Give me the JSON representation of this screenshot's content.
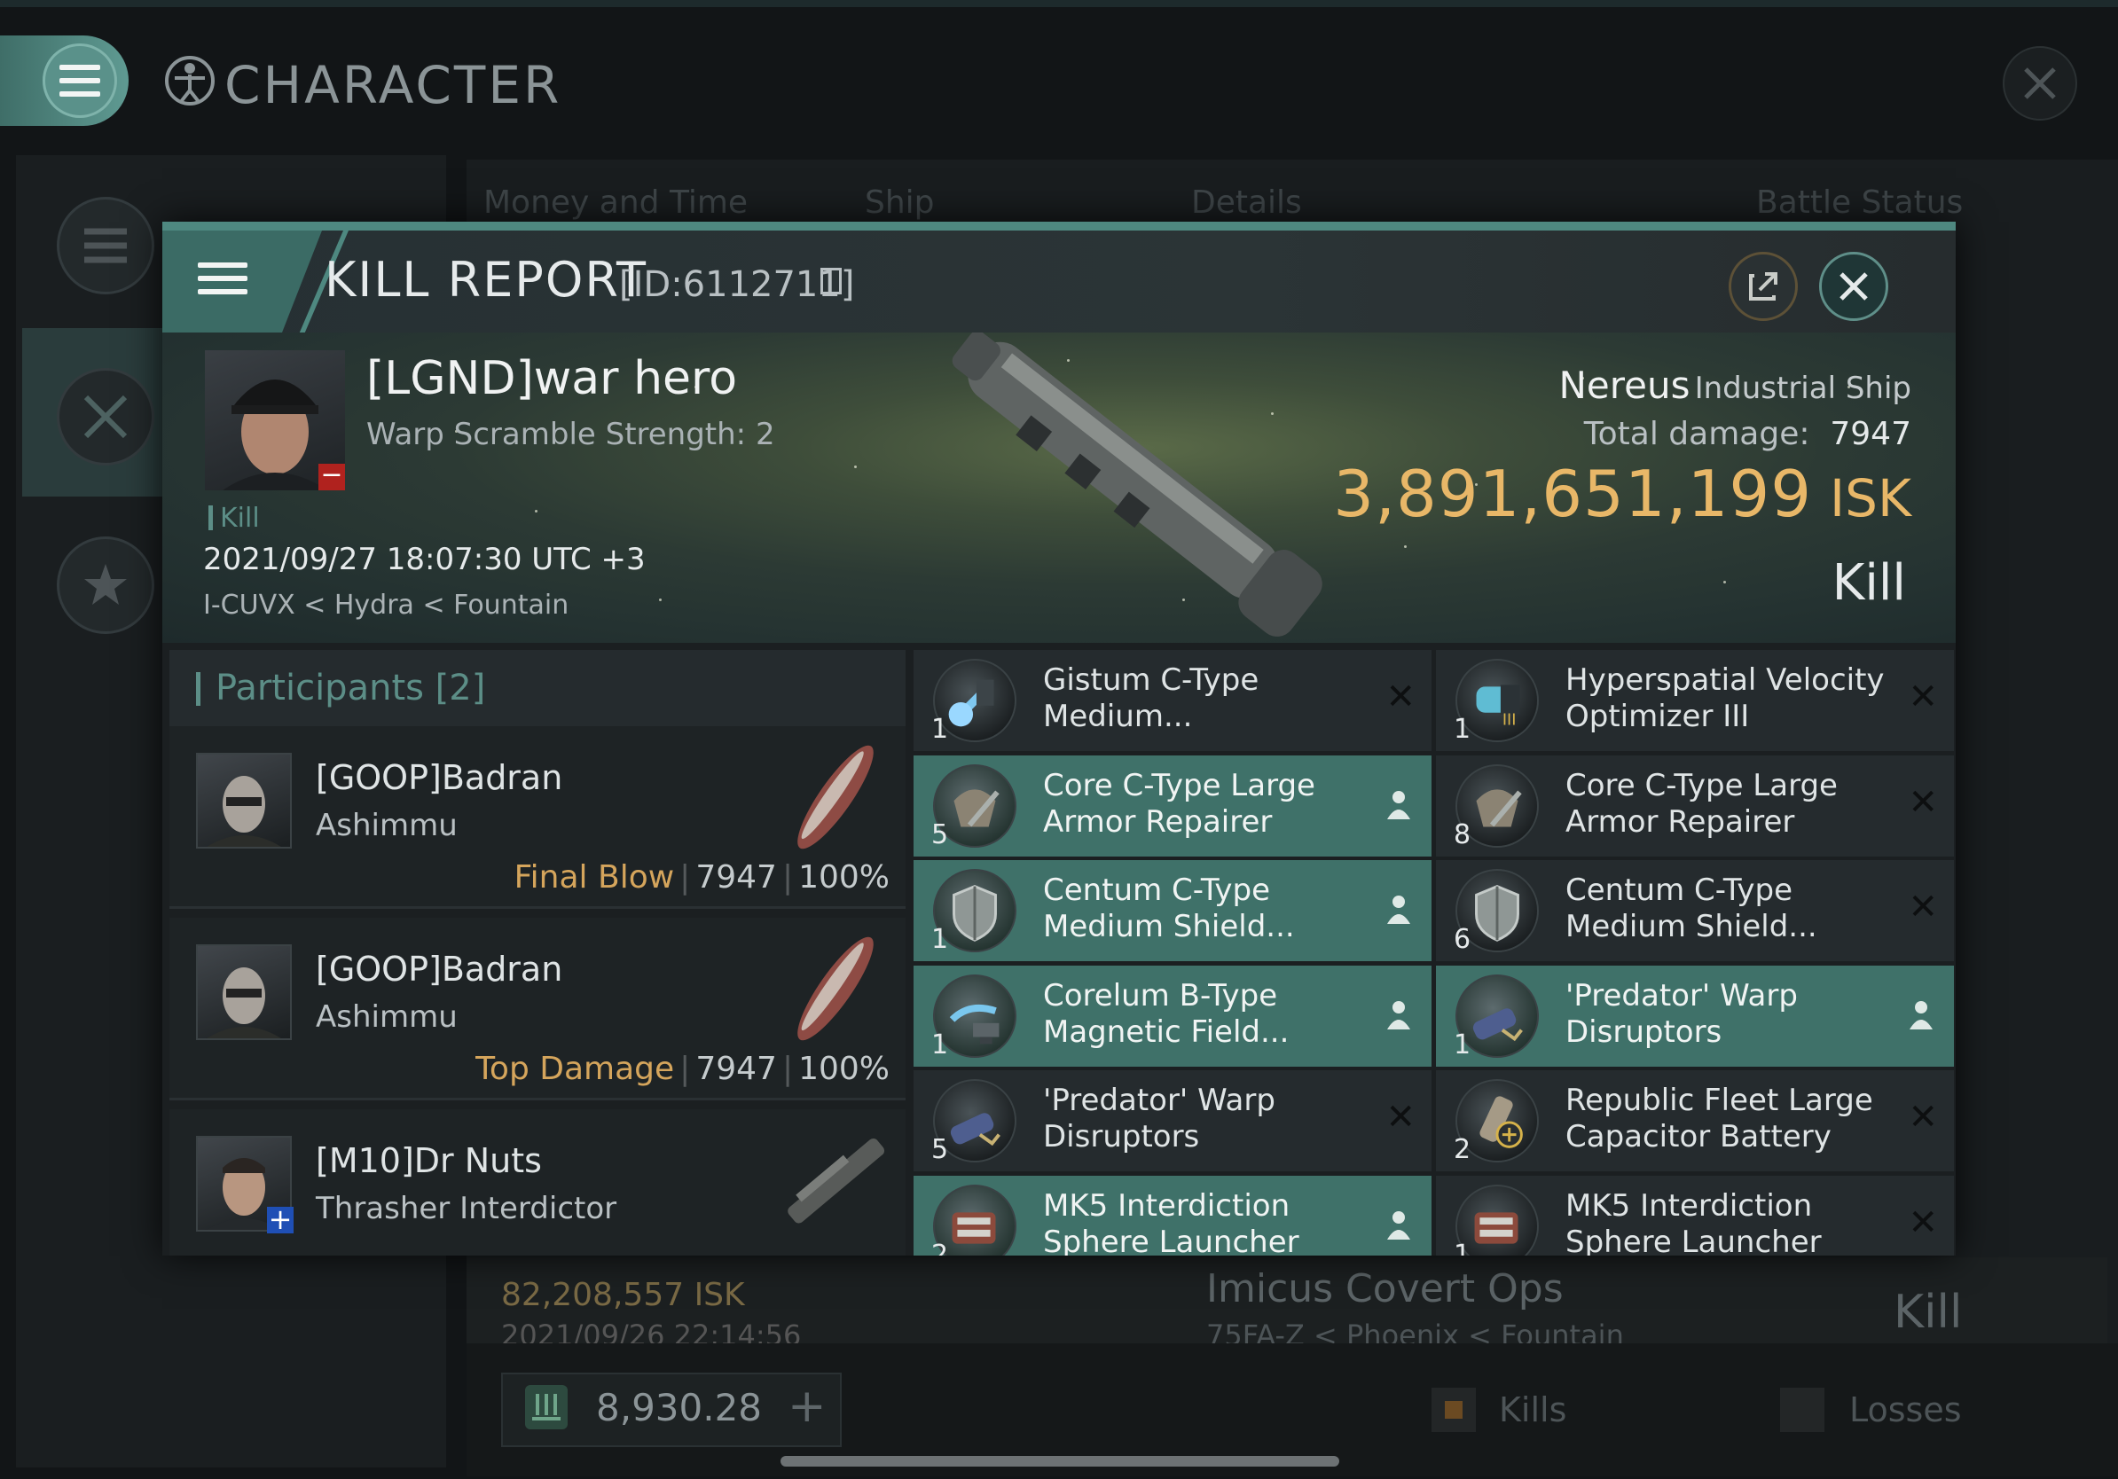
{
  "app": {
    "title": "CHARACTER",
    "icons": {
      "menu": "hamburger-icon",
      "character": "vitruvian-icon",
      "close": "close-icon"
    }
  },
  "background": {
    "tabs": [
      "Money and Time",
      "Ship",
      "Details",
      "Battle Status"
    ],
    "row": {
      "isk": "82,208,557  ISK",
      "date": "2021/09/26  22:14:56",
      "ship": "Imicus Covert Ops",
      "location": "75FA-Z < Phoenix < Fountain",
      "status": "Kill"
    },
    "wallet": {
      "value": "8,930.28",
      "plus": "+"
    },
    "filters": {
      "kills": "Kills",
      "losses": "Losses"
    }
  },
  "modal": {
    "title": "KILL REPORT",
    "id": "[ID:6112711]",
    "victim": {
      "name": "[LGND]war hero",
      "subtitle": "Warp Scramble Strength: 2",
      "tag": "Kill",
      "time": "2021/09/27 18:07:30 UTC +3",
      "location": "I-CUVX < Hydra < Fountain",
      "badge": "−"
    },
    "ship": {
      "name": "Nereus",
      "class": "Industrial Ship",
      "damage_label": "Total damage:",
      "damage": "7947",
      "isk": "3,891,651,199",
      "isk_unit": "ISK",
      "result": "Kill"
    },
    "participants": {
      "header": "Participants [2]",
      "items": [
        {
          "name": "[GOOP]Badran",
          "ship": "Ashimmu",
          "label": "Final Blow",
          "damage": "7947",
          "percent": "100%"
        },
        {
          "name": "[GOOP]Badran",
          "ship": "Ashimmu",
          "label": "Top Damage",
          "damage": "7947",
          "percent": "100%"
        },
        {
          "name": "[M10]Dr Nuts",
          "ship": "Thrasher Interdictor",
          "label": "",
          "damage": "",
          "percent": ""
        }
      ]
    },
    "modules": [
      {
        "name": "Gistum C-Type Medium...",
        "qty": "1",
        "state": "destroyed",
        "icon": "shield-booster-icon"
      },
      {
        "name": "Hyperspatial Velocity Optimizer III",
        "qty": "1",
        "state": "destroyed",
        "icon": "rig-icon"
      },
      {
        "name": "Core C-Type Large Armor Repairer",
        "qty": "5",
        "state": "dropped",
        "icon": "armor-repairer-icon"
      },
      {
        "name": "Core C-Type Large Armor Repairer",
        "qty": "8",
        "state": "destroyed",
        "icon": "armor-repairer-icon"
      },
      {
        "name": "Centum C-Type Medium Shield...",
        "qty": "1",
        "state": "dropped",
        "icon": "shield-extender-icon"
      },
      {
        "name": "Centum C-Type Medium Shield...",
        "qty": "6",
        "state": "destroyed",
        "icon": "shield-extender-icon"
      },
      {
        "name": "Corelum B-Type Magnetic Field...",
        "qty": "1",
        "state": "dropped",
        "icon": "magnetic-field-icon"
      },
      {
        "name": "'Predator' Warp Disruptors",
        "qty": "1",
        "state": "dropped",
        "icon": "warp-disruptor-icon"
      },
      {
        "name": "'Predator' Warp Disruptors",
        "qty": "5",
        "state": "destroyed",
        "icon": "warp-disruptor-icon"
      },
      {
        "name": "Republic Fleet Large Capacitor Battery",
        "qty": "2",
        "state": "destroyed",
        "icon": "capacitor-battery-icon"
      },
      {
        "name": "MK5 Interdiction Sphere Launcher",
        "qty": "2",
        "state": "dropped",
        "icon": "launcher-icon"
      },
      {
        "name": "MK5 Interdiction Sphere Launcher",
        "qty": "1",
        "state": "destroyed",
        "icon": "launcher-icon"
      }
    ]
  },
  "colors": {
    "accent": "#5c8e87",
    "isk": "#e8b768",
    "dropped": "#3f7169",
    "destroyed": "#252b2e"
  }
}
